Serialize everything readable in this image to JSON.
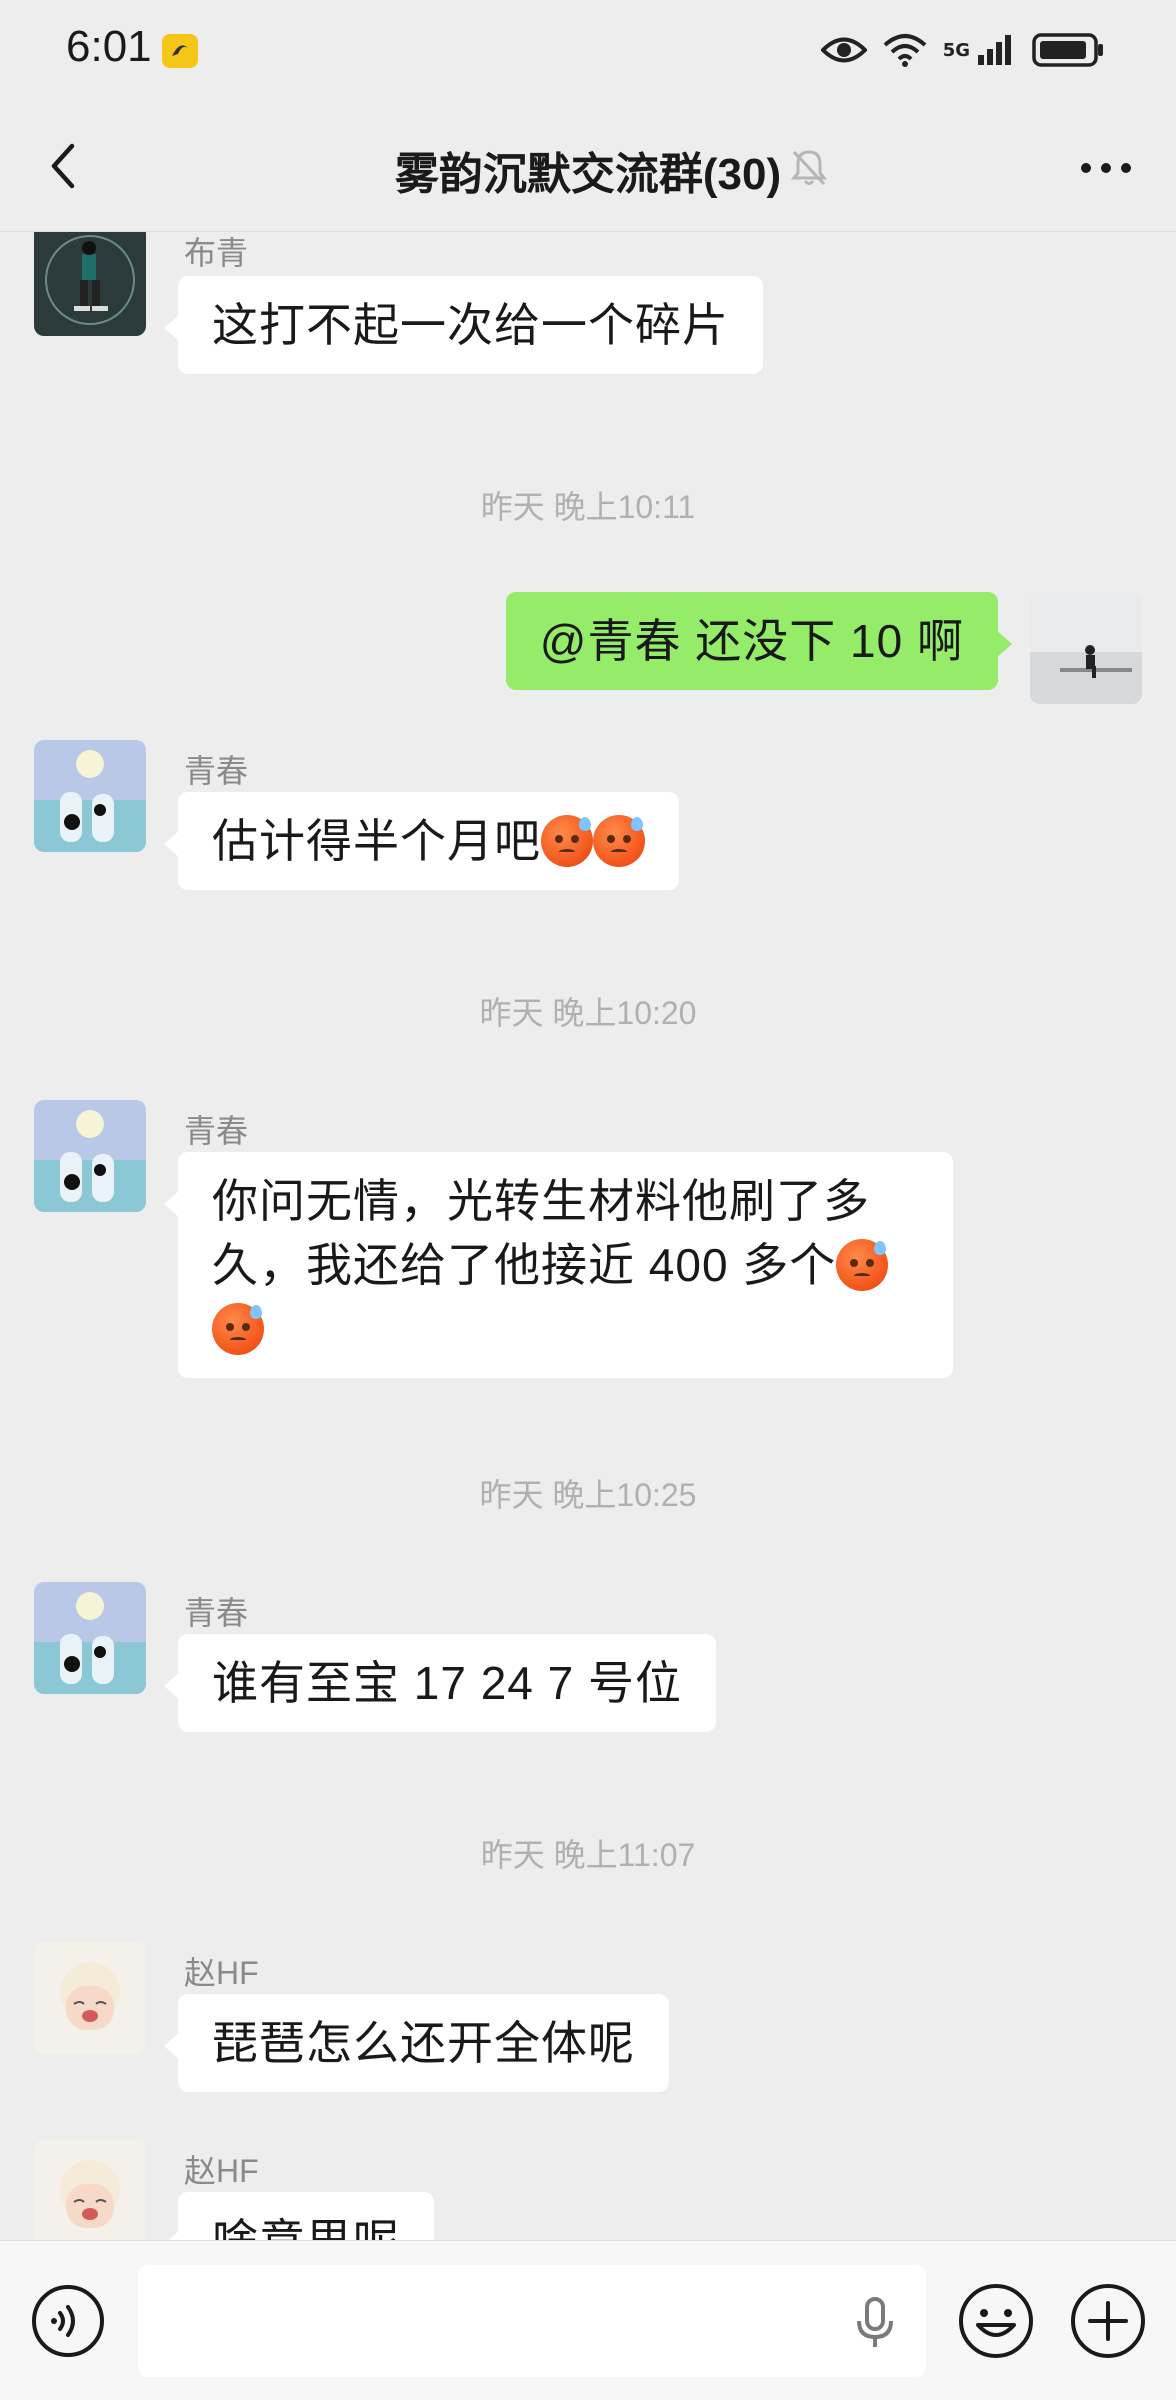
{
  "status_bar": {
    "time": "6:01",
    "network": "5G",
    "icons": [
      "app-notification-icon",
      "eye-icon",
      "wifi-icon",
      "signal-icon",
      "battery-icon"
    ]
  },
  "header": {
    "title": "雾韵沉默交流群(30)",
    "back_icon": "chevron-left-icon",
    "mute_icon": "bell-off-icon",
    "more_icon": "more-dots-icon"
  },
  "messages": [
    {
      "type": "incoming",
      "sender": "布青",
      "text": "这打不起一次给一个碎片"
    },
    {
      "type": "timestamp",
      "text": "昨天 晚上10:11"
    },
    {
      "type": "outgoing",
      "text": "@青春  还没下 10 啊"
    },
    {
      "type": "incoming",
      "sender": "青春",
      "text": "估计得半个月吧",
      "emoji_count": 2
    },
    {
      "type": "timestamp",
      "text": "昨天 晚上10:20"
    },
    {
      "type": "incoming",
      "sender": "青春",
      "line1": "你问无情，光转生材料他刷了多",
      "line2": "久，我还给了他接近 400 多个"
    },
    {
      "type": "timestamp",
      "text": "昨天 晚上10:25"
    },
    {
      "type": "incoming",
      "sender": "青春",
      "text": "谁有至宝 17 24 7 号位"
    },
    {
      "type": "timestamp",
      "text": "昨天 晚上11:07"
    },
    {
      "type": "incoming",
      "sender": "赵HF",
      "text": "琵琶怎么还开全体呢"
    },
    {
      "type": "incoming",
      "sender": "赵HF",
      "text": "啥意思呢"
    }
  ],
  "input_bar": {
    "voice_icon": "voice-mode-icon",
    "input_value": "",
    "mic_icon": "microphone-icon",
    "emoji_icon": "smiley-icon",
    "plus_icon": "plus-circle-icon"
  },
  "colors": {
    "background": "#ededed",
    "bubble_incoming": "#ffffff",
    "bubble_outgoing": "#95ec69",
    "timestamp": "#b0b0b0",
    "sender_name": "#8a8a8a"
  }
}
